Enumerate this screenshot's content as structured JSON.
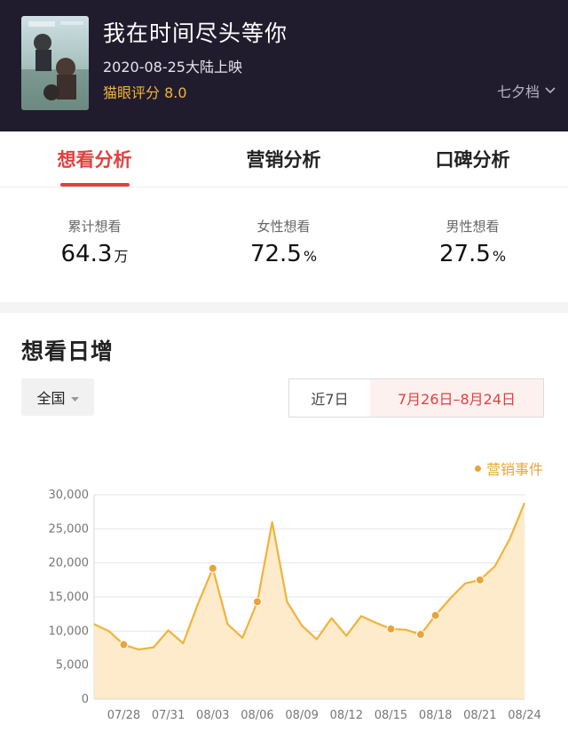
{
  "movie": {
    "title": "我在时间尽头等你",
    "release": "2020-08-25大陆上映",
    "rating_label": "猫眼评分 8.0",
    "festival": "七夕档"
  },
  "tabs": [
    {
      "label": "想看分析",
      "active": true
    },
    {
      "label": "营销分析",
      "active": false
    },
    {
      "label": "口碑分析",
      "active": false
    }
  ],
  "stats": [
    {
      "label": "累计想看",
      "value": "64.3",
      "unit": "万"
    },
    {
      "label": "女性想看",
      "value": "72.5",
      "unit": "%"
    },
    {
      "label": "男性想看",
      "value": "27.5",
      "unit": "%"
    }
  ],
  "section": {
    "title": "想看日增",
    "region": "全国",
    "range_7d": "近7日",
    "range_custom": "7月26日–8月24日",
    "legend": "营销事件"
  },
  "colors": {
    "header_bg": "#211c2d",
    "accent_red": "#e0403f",
    "rating_gold": "#f0b33c",
    "line": "#f0b33c",
    "fill": "#fdebcb",
    "event_dot": "#e8a43a"
  },
  "chart_data": {
    "type": "area",
    "x": [
      "07/26",
      "07/27",
      "07/28",
      "07/29",
      "07/30",
      "07/31",
      "08/01",
      "08/02",
      "08/03",
      "08/04",
      "08/05",
      "08/06",
      "08/07",
      "08/08",
      "08/09",
      "08/10",
      "08/11",
      "08/12",
      "08/13",
      "08/14",
      "08/15",
      "08/16",
      "08/17",
      "08/18",
      "08/19",
      "08/20",
      "08/21",
      "08/22",
      "08/23",
      "08/24"
    ],
    "values": [
      11000,
      10000,
      8000,
      7300,
      7600,
      10100,
      8200,
      14000,
      19200,
      11000,
      9000,
      14300,
      26000,
      14300,
      10800,
      8800,
      11900,
      9300,
      12200,
      11200,
      10300,
      10200,
      9500,
      12300,
      14800,
      17000,
      17500,
      19500,
      23500,
      28800
    ],
    "event_indices": [
      2,
      8,
      11,
      20,
      22,
      23,
      26
    ],
    "x_ticks": [
      "07/28",
      "07/31",
      "08/03",
      "08/06",
      "08/09",
      "08/12",
      "08/15",
      "08/18",
      "08/21",
      "08/24"
    ],
    "y_ticks": [
      "30,000",
      "25,000",
      "20,000",
      "15,000",
      "10,000",
      "5,000",
      "0"
    ],
    "ylim": [
      0,
      30000
    ],
    "grid": true,
    "legend_position": "top-right"
  }
}
